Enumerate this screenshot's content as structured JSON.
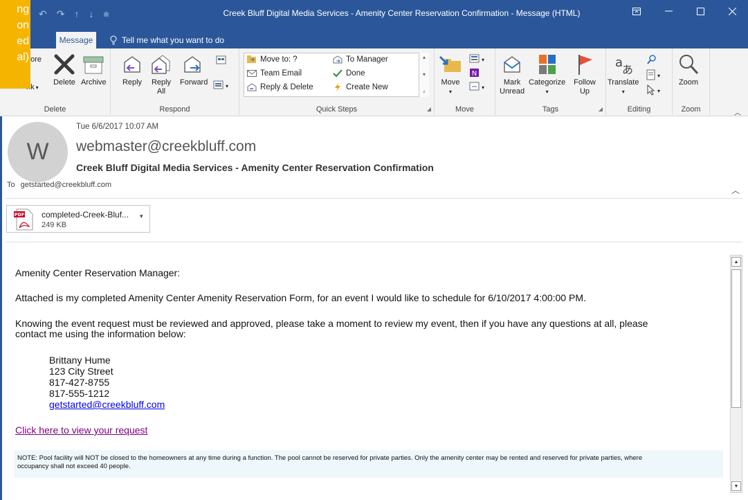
{
  "window": {
    "title": "Creek Bluff Digital Media Services - Amenity Center Reservation Confirmation  -  Message (HTML)"
  },
  "callout": {
    "lines": [
      "ng",
      "on",
      "ed",
      "al)"
    ]
  },
  "ribbon": {
    "tabs": {
      "message": "Message",
      "tell_me": "Tell me what you want to do"
    },
    "delete_group": {
      "label": "Delete",
      "more": "nore",
      "junk": "nk",
      "delete": "Delete",
      "archive": "Archive"
    },
    "respond_group": {
      "label": "Respond",
      "reply": "Reply",
      "reply_all_1": "Reply",
      "reply_all_2": "All",
      "forward": "Forward"
    },
    "quick_steps": {
      "label": "Quick Steps",
      "move_to": "Move to: ?",
      "team_email": "Team Email",
      "reply_delete": "Reply & Delete",
      "to_manager": "To Manager",
      "done": "Done",
      "create_new": "Create New"
    },
    "move_group": {
      "label": "Move",
      "move": "Move"
    },
    "tags_group": {
      "label": "Tags",
      "mark_unread_1": "Mark",
      "mark_unread_2": "Unread",
      "categorize": "Categorize",
      "follow_up_1": "Follow",
      "follow_up_2": "Up"
    },
    "editing_group": {
      "label": "Editing",
      "translate": "Translate"
    },
    "zoom_group": {
      "label": "Zoom",
      "zoom": "Zoom"
    }
  },
  "message": {
    "date": "Tue 6/6/2017 10:07 AM",
    "avatar_letter": "W",
    "sender": "webmaster@creekbluff.com",
    "subject": "Creek Bluff Digital Media Services - Amenity Center Reservation Confirmation",
    "to_label": "To",
    "to": "getstarted@creekbluff.com",
    "attachment": {
      "name": "completed-Creek-Bluf...",
      "size": "249 KB"
    }
  },
  "body": {
    "greeting": "Amenity Center Reservation Manager:",
    "p1": "Attached is my completed Amenity Center Amenity Reservation Form, for an event I would like to schedule for 6/10/2017 4:00:00 PM.",
    "p2_line1": "Knowing the event request must be reviewed and approved, please take a moment to review my event, then if you have any questions at all, please",
    "p2_line2": "contact me using the information below:",
    "contact": {
      "name": "Brittany Hume",
      "street": "123 City Street",
      "phone1": "817-427-8755",
      "phone2": "817-555-1212",
      "email": "getstarted@creekbluff.com"
    },
    "request_link": "Click here to view your request",
    "note_line1": "NOTE: Pool facility will NOT be closed to the homeowners at any time during a function. The pool cannot be reserved for private parties. Only the amenity center may be rented and reserved for private parties, where",
    "note_line2": "occupancy shall not exceed 40 people."
  }
}
